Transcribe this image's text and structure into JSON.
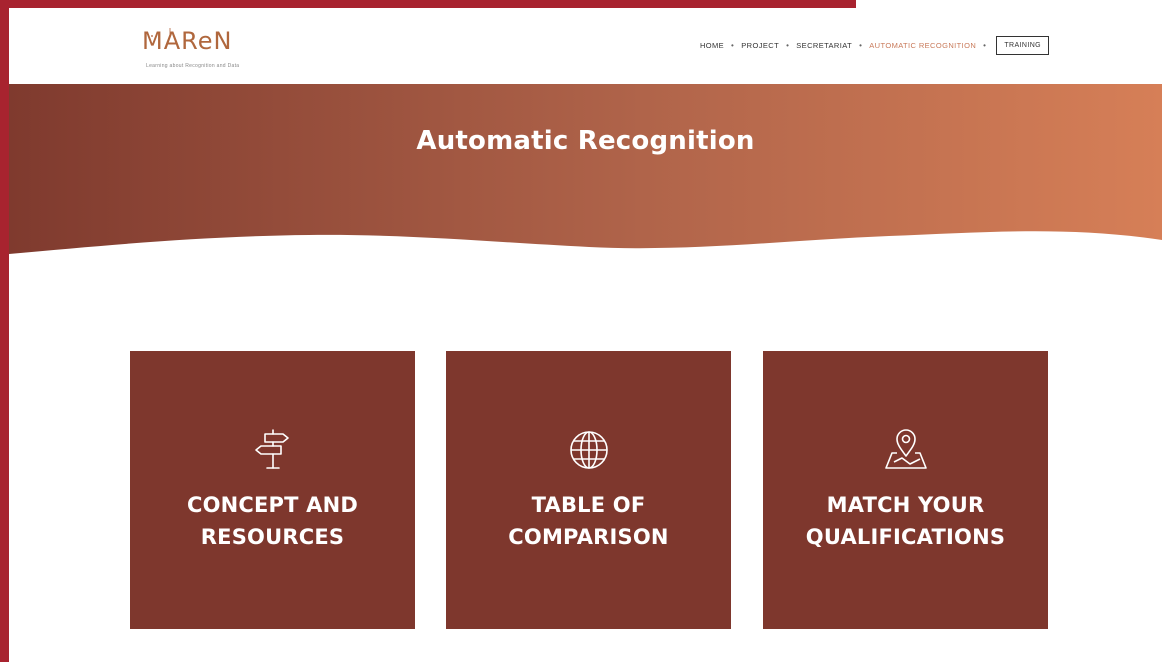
{
  "header": {
    "logo_text": "MAReN",
    "logo_tagline": "Learning about Recognition and Data",
    "nav": [
      {
        "label": "HOME",
        "active": false
      },
      {
        "label": "PROJECT",
        "active": false
      },
      {
        "label": "SECRETARIAT",
        "active": false
      },
      {
        "label": "AUTOMATIC RECOGNITION",
        "active": true
      }
    ],
    "nav_separator": "•",
    "cta_label": "TRAINING"
  },
  "hero": {
    "title": "Automatic Recognition"
  },
  "cards": [
    {
      "title": "CONCEPT AND\nRESOURCES",
      "icon": "signpost-icon"
    },
    {
      "title": "TABLE OF\nCOMPARISON",
      "icon": "globe-icon"
    },
    {
      "title": "MATCH YOUR\nQUALIFICATIONS",
      "icon": "map-pin-icon"
    }
  ],
  "colors": {
    "frame": "#a8232f",
    "card_bg": "#7e372d",
    "hero_gradient_start": "#7f3a2e",
    "hero_gradient_end": "#d67f57",
    "active_nav": "#c97a5a"
  }
}
